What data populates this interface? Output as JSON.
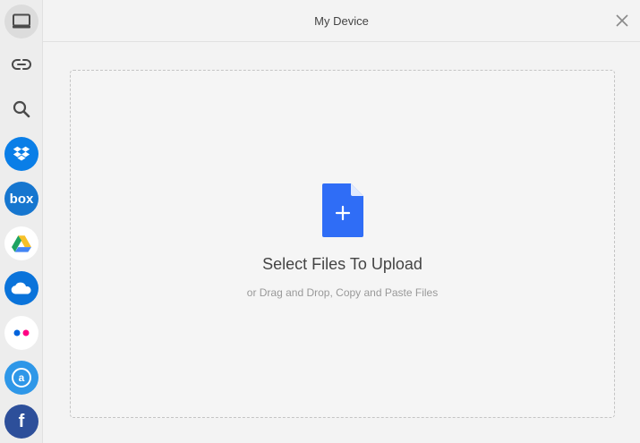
{
  "header": {
    "title": "My Device"
  },
  "sidebar": {
    "items": [
      {
        "name": "my-device",
        "icon": "monitor-icon",
        "color": "#4a4a4a",
        "bg": "#dcdcdc"
      },
      {
        "name": "link",
        "icon": "link-icon",
        "color": "#4a4a4a",
        "bg": "transparent"
      },
      {
        "name": "web-search",
        "icon": "search-icon",
        "color": "#4a4a4a",
        "bg": "transparent"
      },
      {
        "name": "dropbox",
        "icon": "dropbox-icon",
        "color": "#ffffff",
        "bg": "#0a7ee7"
      },
      {
        "name": "box",
        "icon": "box-icon",
        "color": "#ffffff",
        "bg": "#1676cf",
        "label": "box"
      },
      {
        "name": "google-drive",
        "icon": "google-drive-icon",
        "color": "#ffffff",
        "bg": "#ffffff"
      },
      {
        "name": "onedrive",
        "icon": "onedrive-icon",
        "color": "#ffffff",
        "bg": "#0a73da"
      },
      {
        "name": "flickr",
        "icon": "flickr-icon",
        "color": "#ffffff",
        "bg": "#ffffff"
      },
      {
        "name": "amazon",
        "icon": "amazon-icon",
        "color": "#ffffff",
        "bg": "#2e97e8",
        "label": "a"
      },
      {
        "name": "facebook",
        "icon": "facebook-icon",
        "color": "#ffffff",
        "bg": "#2d4f9a",
        "label": "f"
      }
    ]
  },
  "dropzone": {
    "icon": "file-plus-icon",
    "title": "Select Files To Upload",
    "subtitle": "or Drag and Drop, Copy and Paste Files"
  },
  "colors": {
    "accent": "#2f6df6",
    "text": "#444444",
    "muted": "#999999"
  }
}
